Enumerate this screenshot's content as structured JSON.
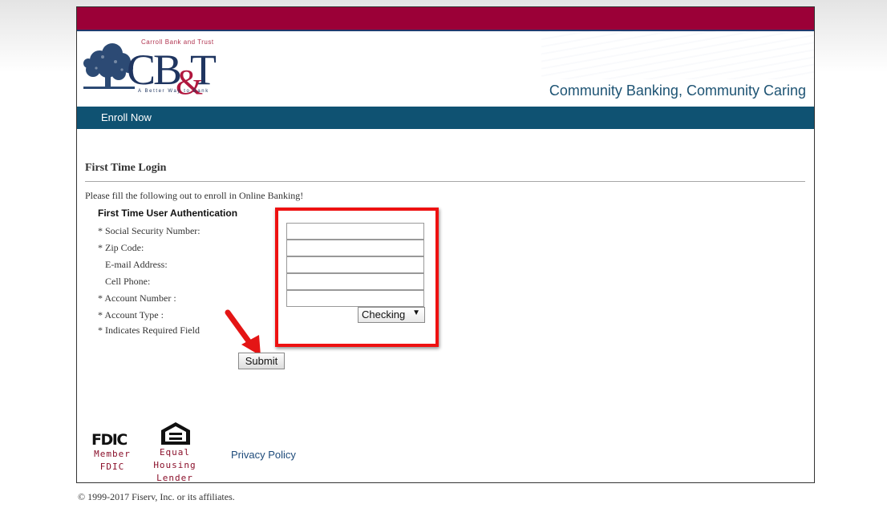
{
  "header": {
    "bank_name": "Carroll Bank and Trust",
    "logo_letters": "CB&T",
    "logo_tagline": "A Better Way to Bank",
    "slogan": "Community Banking, Community Caring"
  },
  "nav": {
    "enroll": "Enroll Now"
  },
  "page": {
    "title": "First Time Login",
    "intro": "Please fill the following out to enroll in Online Banking!"
  },
  "form": {
    "section_title": "First Time User Authentication",
    "labels": {
      "ssn": "* Social Security Number:",
      "zip": "* Zip Code:",
      "email": "E-mail Address:",
      "cell": "Cell Phone:",
      "account_number": "* Account Number :",
      "account_type": "* Account Type :",
      "required_note": "* Indicates Required Field"
    },
    "values": {
      "ssn": "",
      "zip": "",
      "email": "",
      "cell": "",
      "account_number": ""
    },
    "account_type_selected": "Checking",
    "submit_label": "Submit"
  },
  "footer": {
    "fdic_logo": "FDIC",
    "fdic_line1": "Member",
    "fdic_line2": "FDIC",
    "ehl_line1": "Equal",
    "ehl_line2": "Housing",
    "ehl_line3": "Lender",
    "privacy": "Privacy Policy",
    "copyright": "© 1999-2017 Fiserv, Inc. or its affiliates."
  },
  "colors": {
    "top_bar": "#9b0037",
    "nav_bar": "#0f5272",
    "slogan": "#1d5373",
    "highlight": "#ee1111"
  },
  "icons": {
    "arrow": "red-arrow-icon",
    "fdic": "fdic-logo-icon",
    "housing": "equal-housing-icon",
    "tree": "tree-icon"
  }
}
